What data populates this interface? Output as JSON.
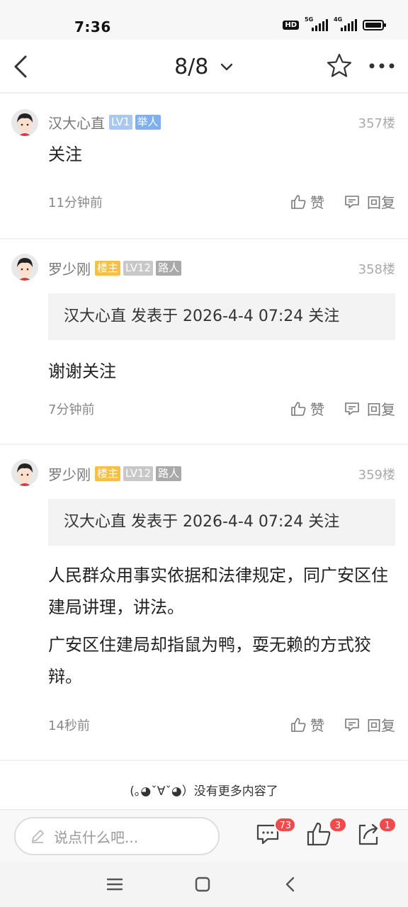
{
  "status": {
    "time": "7:36",
    "hd": "HD",
    "sim1": "5G",
    "sim2": "4G",
    "battery_level": 0.85
  },
  "header": {
    "pager": "8/8"
  },
  "posts": [
    {
      "username": "汉大心直",
      "tags": [
        "LV1",
        "举人"
      ],
      "floor": "357楼",
      "content": [
        "关注"
      ],
      "time": "11分钟前",
      "like_label": "赞",
      "reply_label": "回复"
    },
    {
      "username": "罗少刚",
      "tags": [
        "楼主",
        "LV12",
        "路人"
      ],
      "floor": "358楼",
      "quote": "汉大心直 发表于 2026-4-4 07:24 关注",
      "content": [
        "谢谢关注"
      ],
      "time": "7分钟前",
      "like_label": "赞",
      "reply_label": "回复"
    },
    {
      "username": "罗少刚",
      "tags": [
        "楼主",
        "LV12",
        "路人"
      ],
      "floor": "359楼",
      "quote": "汉大心直 发表于 2026-4-4 07:24 关注",
      "content": [
        "人民群众用事实依据和法律规定，同广安区住建局讲理，讲法。",
        "广安区住建局却指鼠为鸭，耍无赖的方式狡辩。"
      ],
      "time": "14秒前",
      "like_label": "赞",
      "reply_label": "回复"
    }
  ],
  "end_note": "(｡◕ˇ∀ˇ◕）没有更多内容了",
  "bottom": {
    "placeholder": "说点什么吧...",
    "comment_count": "73",
    "like_count": "3",
    "share_count": "1"
  },
  "colors": {
    "badge": "#f24a4a",
    "tag_louzhu": "#f6c045",
    "tag_lv1": "#a8c8f0",
    "tag_juren": "#7fb0ee"
  }
}
